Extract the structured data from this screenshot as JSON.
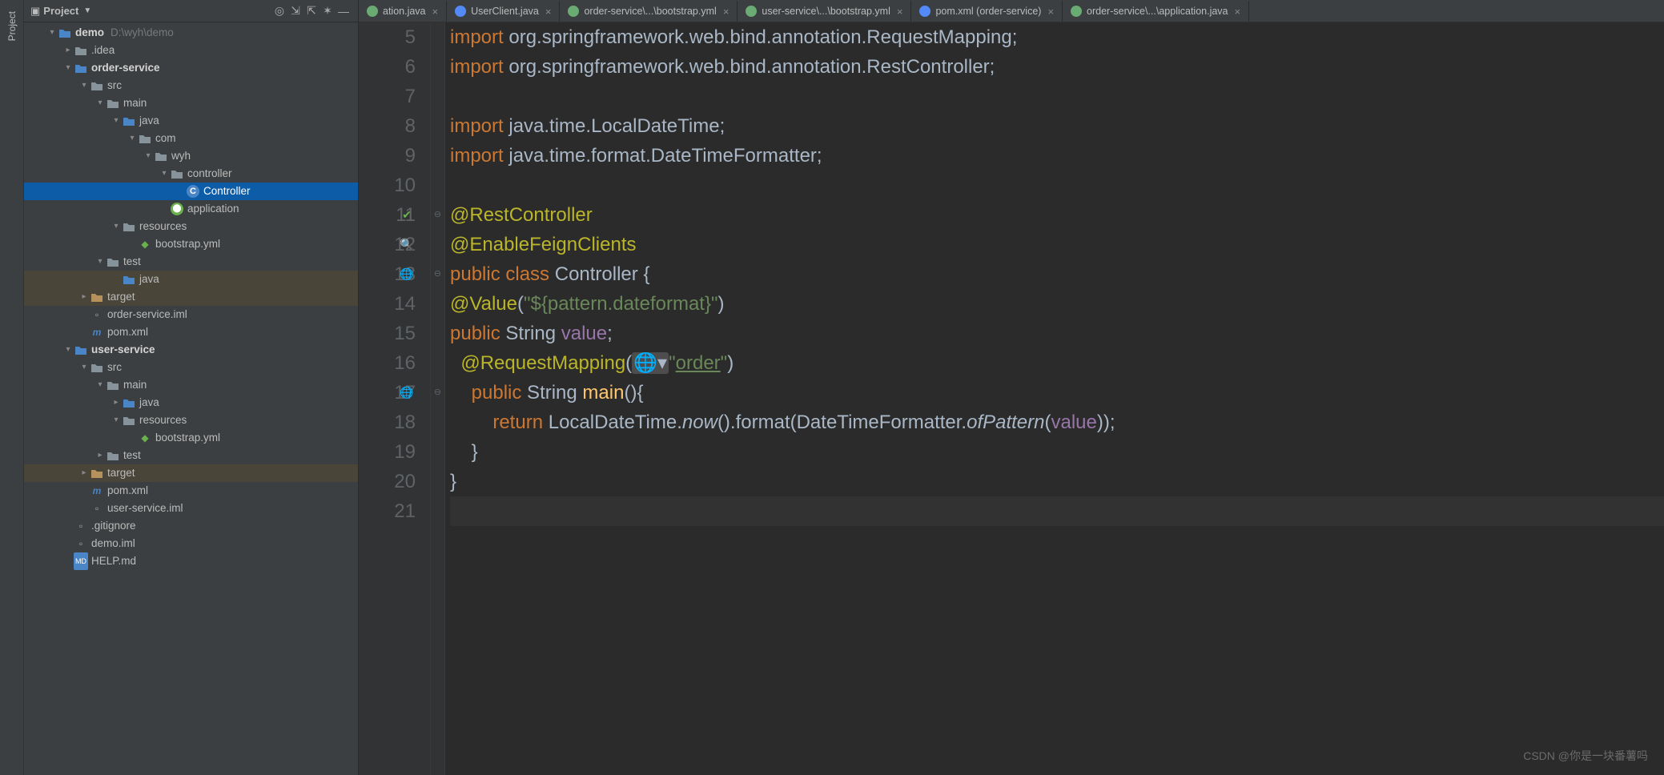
{
  "panel": {
    "title": "Project"
  },
  "tree": {
    "root": {
      "name": "demo",
      "path": "D:\\wyh\\demo"
    },
    "items": [
      {
        "indent": 1,
        "chev": "v",
        "icon": "folder-blue",
        "label": "demo",
        "bold": true,
        "extra": "D:\\wyh\\demo"
      },
      {
        "indent": 2,
        "chev": ">",
        "icon": "folder",
        "label": ".idea"
      },
      {
        "indent": 2,
        "chev": "v",
        "icon": "folder-blue",
        "label": "order-service",
        "bold": true
      },
      {
        "indent": 3,
        "chev": "v",
        "icon": "folder",
        "label": "src"
      },
      {
        "indent": 4,
        "chev": "v",
        "icon": "folder",
        "label": "main"
      },
      {
        "indent": 5,
        "chev": "v",
        "icon": "folder-blue",
        "label": "java"
      },
      {
        "indent": 6,
        "chev": "v",
        "icon": "folder",
        "label": "com"
      },
      {
        "indent": 7,
        "chev": "v",
        "icon": "folder",
        "label": "wyh"
      },
      {
        "indent": 8,
        "chev": "v",
        "icon": "folder",
        "label": "controller"
      },
      {
        "indent": 9,
        "chev": "",
        "icon": "class",
        "label": "Controller",
        "selected": true
      },
      {
        "indent": 8,
        "chev": "",
        "icon": "spring",
        "label": "application"
      },
      {
        "indent": 5,
        "chev": "v",
        "icon": "folder",
        "label": "resources"
      },
      {
        "indent": 6,
        "chev": "",
        "icon": "yml",
        "label": "bootstrap.yml"
      },
      {
        "indent": 4,
        "chev": "v",
        "icon": "folder",
        "label": "test"
      },
      {
        "indent": 5,
        "chev": "",
        "icon": "folder-blue",
        "label": "java",
        "shade": true
      },
      {
        "indent": 3,
        "chev": ">",
        "icon": "folder-yellow",
        "label": "target",
        "shade": true
      },
      {
        "indent": 3,
        "chev": "",
        "icon": "file",
        "label": "order-service.iml"
      },
      {
        "indent": 3,
        "chev": "",
        "icon": "maven",
        "label": "pom.xml"
      },
      {
        "indent": 2,
        "chev": "v",
        "icon": "folder-blue",
        "label": "user-service",
        "bold": true
      },
      {
        "indent": 3,
        "chev": "v",
        "icon": "folder",
        "label": "src"
      },
      {
        "indent": 4,
        "chev": "v",
        "icon": "folder",
        "label": "main"
      },
      {
        "indent": 5,
        "chev": ">",
        "icon": "folder-blue",
        "label": "java"
      },
      {
        "indent": 5,
        "chev": "v",
        "icon": "folder",
        "label": "resources"
      },
      {
        "indent": 6,
        "chev": "",
        "icon": "yml",
        "label": "bootstrap.yml"
      },
      {
        "indent": 4,
        "chev": ">",
        "icon": "folder",
        "label": "test"
      },
      {
        "indent": 3,
        "chev": ">",
        "icon": "folder-yellow",
        "label": "target",
        "shade": true
      },
      {
        "indent": 3,
        "chev": "",
        "icon": "maven",
        "label": "pom.xml"
      },
      {
        "indent": 3,
        "chev": "",
        "icon": "file",
        "label": "user-service.iml"
      },
      {
        "indent": 2,
        "chev": "",
        "icon": "file",
        "label": ".gitignore"
      },
      {
        "indent": 2,
        "chev": "",
        "icon": "file",
        "label": "demo.iml"
      },
      {
        "indent": 2,
        "chev": "",
        "icon": "md",
        "label": "HELP.md"
      }
    ]
  },
  "tabs": [
    {
      "icon": "#6aab73",
      "label": "ation.java"
    },
    {
      "icon": "#548af7",
      "label": "UserClient.java"
    },
    {
      "icon": "#6aab73",
      "label": "order-service\\...\\bootstrap.yml"
    },
    {
      "icon": "#6aab73",
      "label": "user-service\\...\\bootstrap.yml"
    },
    {
      "icon": "#548af7",
      "label": "pom.xml (order-service)"
    },
    {
      "icon": "#6aab73",
      "label": "order-service\\...\\application.java"
    }
  ],
  "code": {
    "start": 5,
    "lines": [
      "import org.springframework.web.bind.annotation.RequestMapping;",
      "import org.springframework.web.bind.annotation.RestController;",
      "",
      "import java.time.LocalDateTime;",
      "import java.time.format.DateTimeFormatter;",
      "",
      "@RestController",
      "@EnableFeignClients",
      "public class Controller {",
      "@Value(\"${pattern.dateformat}\")",
      "public String value;",
      "  @RequestMapping(🌐\"order\")",
      "    public String main(){",
      "        return LocalDateTime.now().format(DateTimeFormatter.ofPattern(value));",
      "    }",
      "}",
      ""
    ]
  },
  "watermark": "CSDN @你是一块番薯吗"
}
